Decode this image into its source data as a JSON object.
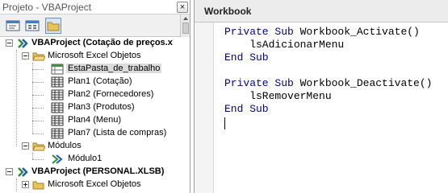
{
  "project_explorer": {
    "title": "Projeto - VBAProject",
    "close_glyph": "×",
    "toolbar": {
      "view_code": "view-code-icon",
      "view_object": "view-object-icon",
      "toggle_folders": "toggle-folders-icon"
    },
    "tree": {
      "project1": {
        "label": "VBAProject (Cotação de preços.x",
        "folder_objects": {
          "label": "Microsoft Excel Objetos",
          "items": [
            "EstaPasta_de_trabalho",
            "Plan1 (Cotação)",
            "Plan2 (Fornecedores)",
            "Plan3 (Produtos)",
            "Plan4 (Menu)",
            "Plan7 (Lista de compras)"
          ]
        },
        "folder_modules": {
          "label": "Módulos",
          "items": [
            "Módulo1"
          ]
        }
      },
      "project2": {
        "label": "VBAProject (PERSONAL.XLSB)",
        "folder_objects": {
          "label": "Microsoft Excel Objetos"
        }
      }
    }
  },
  "code_window": {
    "object_dropdown": "Workbook",
    "lines": [
      {
        "kw": "Private Sub",
        "rest": " Workbook_Activate()"
      },
      {
        "kw": "",
        "rest": "    lsAdicionarMenu"
      },
      {
        "kw": "End Sub",
        "rest": ""
      },
      {
        "kw": "",
        "rest": ""
      },
      {
        "kw": "Private Sub",
        "rest": " Workbook_Deactivate()"
      },
      {
        "kw": "",
        "rest": "    lsRemoverMenu"
      },
      {
        "kw": "End Sub",
        "rest": ""
      }
    ]
  },
  "colors": {
    "keyword": "#00008b",
    "selection": "#dcdcdc",
    "folder": "#e8c25a"
  }
}
